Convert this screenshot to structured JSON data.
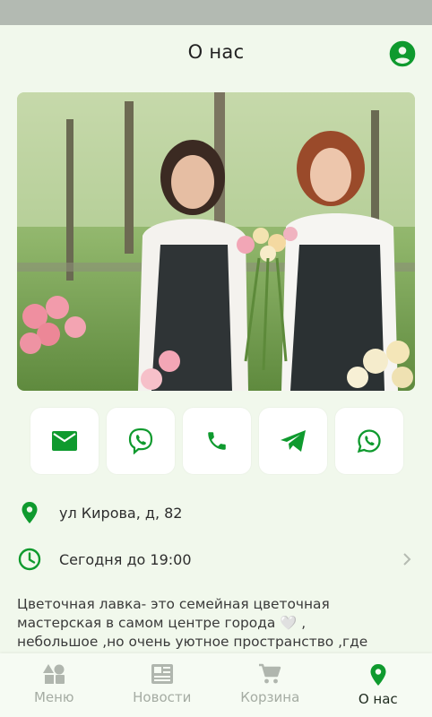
{
  "header": {
    "title": "О нас",
    "profile_icon": "account-circle-icon"
  },
  "photo": {
    "description_icon": "shop-photo"
  },
  "contacts": [
    {
      "name": "email",
      "icon": "email-icon"
    },
    {
      "name": "viber",
      "icon": "viber-icon"
    },
    {
      "name": "phone",
      "icon": "phone-icon"
    },
    {
      "name": "telegram",
      "icon": "telegram-icon"
    },
    {
      "name": "whatsapp",
      "icon": "whatsapp-icon"
    }
  ],
  "address": {
    "icon": "location-pin-icon",
    "text": "ул Кирова, д, 82"
  },
  "hours": {
    "icon": "clock-icon",
    "text": "Сегодня до 19:00"
  },
  "about": {
    "line1": "Цветочная лавка- это семейная цветочная",
    "line2": "мастерская в самом центре города 🤍 ,",
    "line3": "небольшое ,но очень уютное пространство ,где"
  },
  "nav": {
    "menu": "Меню",
    "news": "Новости",
    "cart": "Корзина",
    "about": "О нас"
  },
  "colors": {
    "accent": "#0f9a2e",
    "background": "#f1f8ec",
    "inactive": "#a5aca3"
  }
}
